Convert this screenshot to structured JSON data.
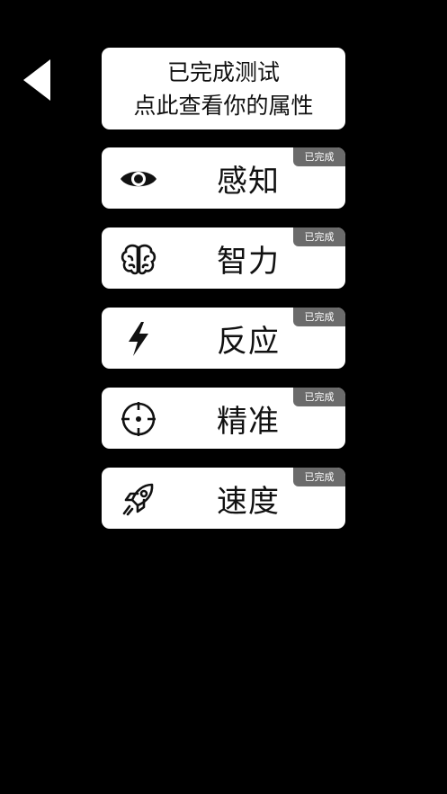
{
  "back": {
    "icon": "back-triangle-icon"
  },
  "summary": {
    "line1": "已完成测试",
    "line2": "点此查看你的属性"
  },
  "tests": [
    {
      "label": "感知",
      "icon": "eye-icon",
      "badge": "已完成"
    },
    {
      "label": "智力",
      "icon": "brain-icon",
      "badge": "已完成"
    },
    {
      "label": "反应",
      "icon": "lightning-icon",
      "badge": "已完成"
    },
    {
      "label": "精准",
      "icon": "crosshair-icon",
      "badge": "已完成"
    },
    {
      "label": "速度",
      "icon": "rocket-icon",
      "badge": "已完成"
    }
  ],
  "colors": {
    "background": "#000000",
    "card": "#ffffff",
    "badge": "#6b6b6b",
    "text": "#111111"
  }
}
